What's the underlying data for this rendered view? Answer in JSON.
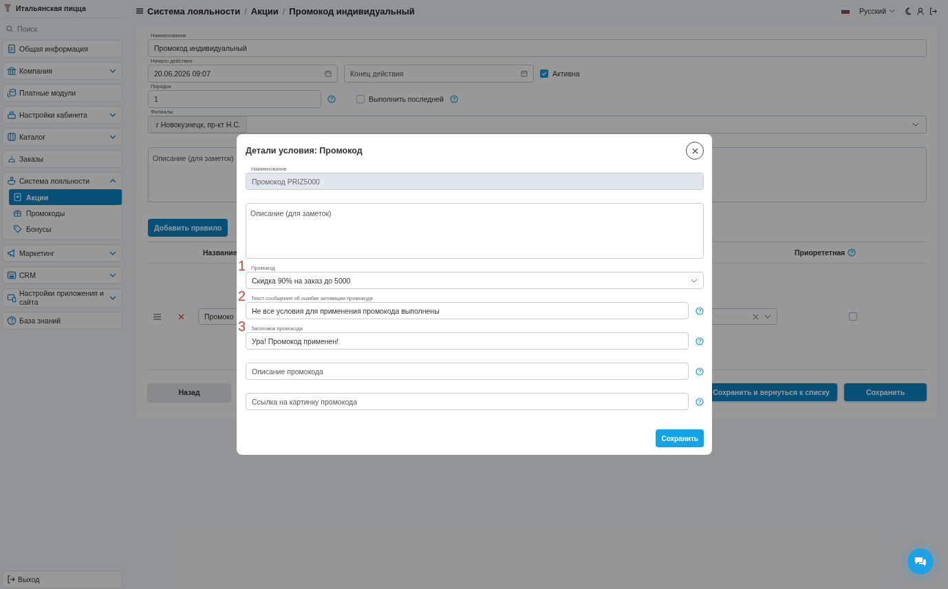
{
  "sidebar": {
    "brand": "Итальянская пицца",
    "search": {
      "placeholder": "Поиск"
    },
    "items": [
      {
        "label": "Общая информация"
      },
      {
        "label": "Компания",
        "expanded": false
      },
      {
        "label": "Платные модули"
      },
      {
        "label": "Настройки кабинета",
        "expanded": false
      },
      {
        "label": "Каталог",
        "expanded": false
      },
      {
        "label": "Заказы"
      },
      {
        "label": "Система лояльности",
        "expanded": true,
        "children": [
          {
            "label": "Акции",
            "selected": true
          },
          {
            "label": "Промокоды",
            "selected": false
          },
          {
            "label": "Бонусы",
            "selected": false
          }
        ]
      },
      {
        "label": "Маркетинг",
        "expanded": false
      },
      {
        "label": "CRM",
        "expanded": false
      },
      {
        "label": "Настройки приложения и сайта",
        "expanded": false
      },
      {
        "label": "База знаний"
      }
    ],
    "logout": "Выход"
  },
  "header": {
    "breadcrumb": [
      "Система лояльности",
      "Акции",
      "Промокод индивидуальный"
    ],
    "separator": "/",
    "language": "Русский"
  },
  "form": {
    "name": {
      "label": "Наименование",
      "value": "Промокод индивидуальный"
    },
    "start": {
      "label": "Начало действия",
      "value": "20.06.2026 09:07"
    },
    "end": {
      "placeholder": "Конец действия"
    },
    "active": {
      "label": "Активна",
      "checked": true
    },
    "order": {
      "label": "Порядок",
      "value": "1"
    },
    "run_last": {
      "label": "Выполнить последней",
      "checked": false
    },
    "branches": {
      "label": "Филиалы",
      "chips": [
        "г Новокузнецк, пр-кт Н.С."
      ]
    },
    "notes": {
      "placeholder": "Описание (для заметок)"
    }
  },
  "add_rule_button": "Добавить правило",
  "rules_table": {
    "columns": [
      "Название",
      "Приорететная"
    ],
    "rows": [
      {
        "condition": "Промоко",
        "priority": false
      }
    ]
  },
  "buttons": [
    "Назад",
    "Сохранить и вернуться к списку",
    "Сохранить"
  ],
  "dialog": {
    "title": "Детали условия: Промокод",
    "fields": [
      {
        "kind": "input",
        "label": "Наименование",
        "value": "Промокод PRIZ5000",
        "disabled": true,
        "help": false
      },
      {
        "kind": "textarea",
        "placeholder": "Описание (для заметок)"
      },
      {
        "kind": "select",
        "marker": "1",
        "label": "Промокод",
        "value": "Скидка 90% на заказ до 5000"
      },
      {
        "kind": "input",
        "marker": "2",
        "label": "Текст сообщения об ошибке активации промокода",
        "value": "Не все условия для применения промокода выполнены",
        "disabled": false,
        "help": true
      },
      {
        "kind": "input",
        "marker": "3",
        "label": "Заголовок промокода",
        "value": "Ура! Промокод применен!",
        "disabled": false,
        "help": true
      },
      {
        "kind": "input",
        "placeholder": "Описание промокода",
        "disabled": false,
        "help": true
      },
      {
        "kind": "input",
        "placeholder": "Ссылка на картинку промокода",
        "disabled": false,
        "help": true
      }
    ],
    "save_button": "Сохранить"
  }
}
